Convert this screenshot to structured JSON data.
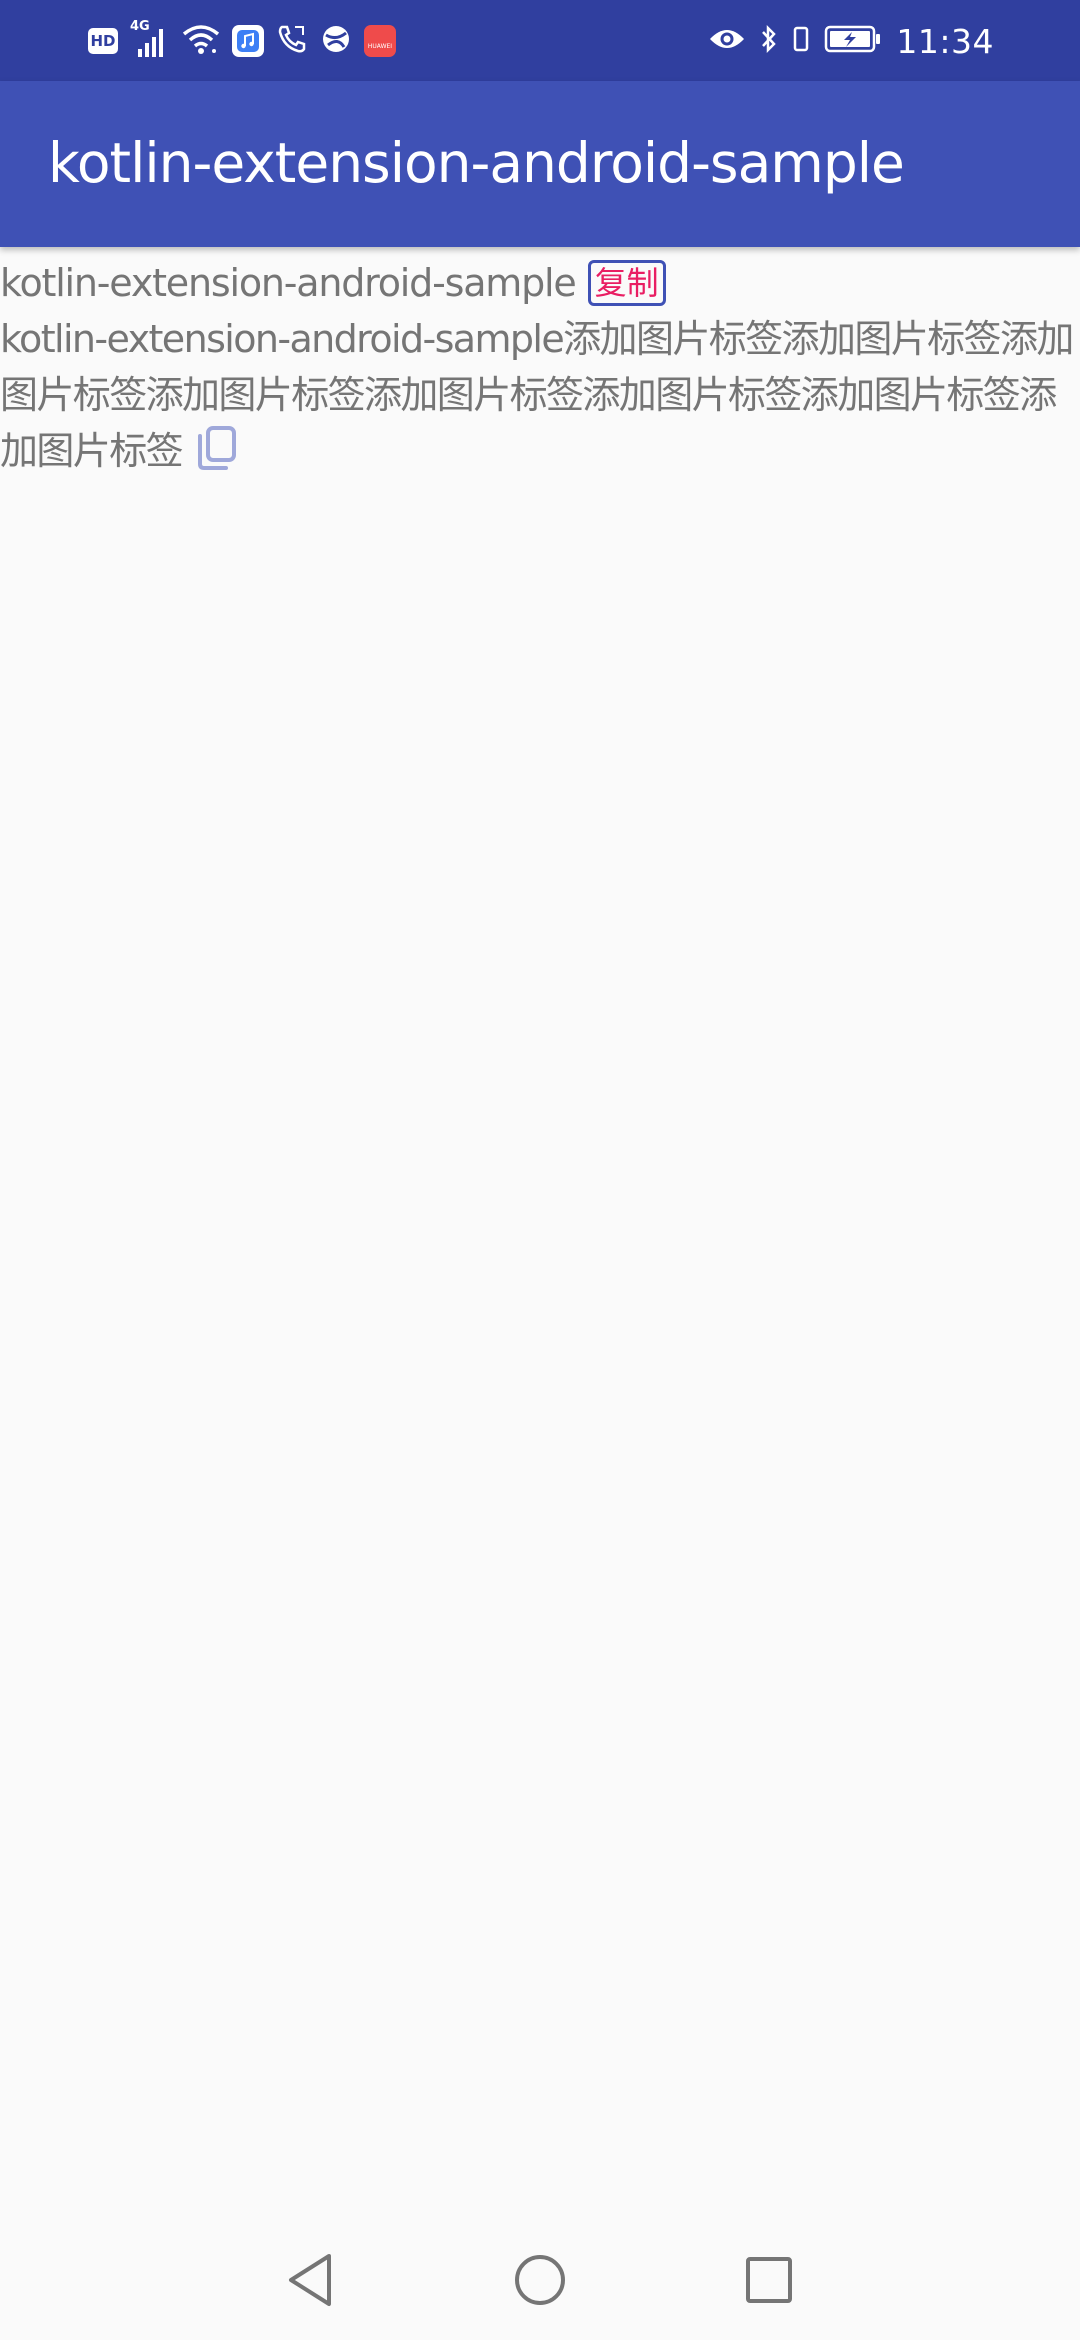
{
  "status_bar": {
    "hd_label": "HD",
    "network_label": "4G",
    "time": "11:34",
    "icons": [
      "hd-icon",
      "signal-icon",
      "wifi-icon",
      "music-app-icon",
      "phone-call-icon",
      "browser-icon",
      "huawei-app-icon",
      "eye-icon",
      "bluetooth-icon",
      "vibrate-icon",
      "battery-charging-icon"
    ],
    "huawei_label": "HUAWEI",
    "background_color": "#303f9f"
  },
  "app_bar": {
    "title": "kotlin-extension-android-sample",
    "background_color": "#3f51b5"
  },
  "content": {
    "line1_text": "kotlin-extension-android-sample",
    "copy_tag_label": "复制",
    "paragraph_text": "kotlin-extension-android-sample添加图片标签添加图片标签添加图片标签添加图片标签添加图片标签添加图片标签添加图片标签添加图片标签",
    "trailing_icon": "copy-icon",
    "text_color": "#757575",
    "tag_text_color": "#e91e63",
    "tag_border_color": "#3f51b5",
    "icon_color": "#9fa8da"
  },
  "nav_bar": {
    "icons": [
      "back-icon",
      "home-icon",
      "recents-icon"
    ]
  }
}
